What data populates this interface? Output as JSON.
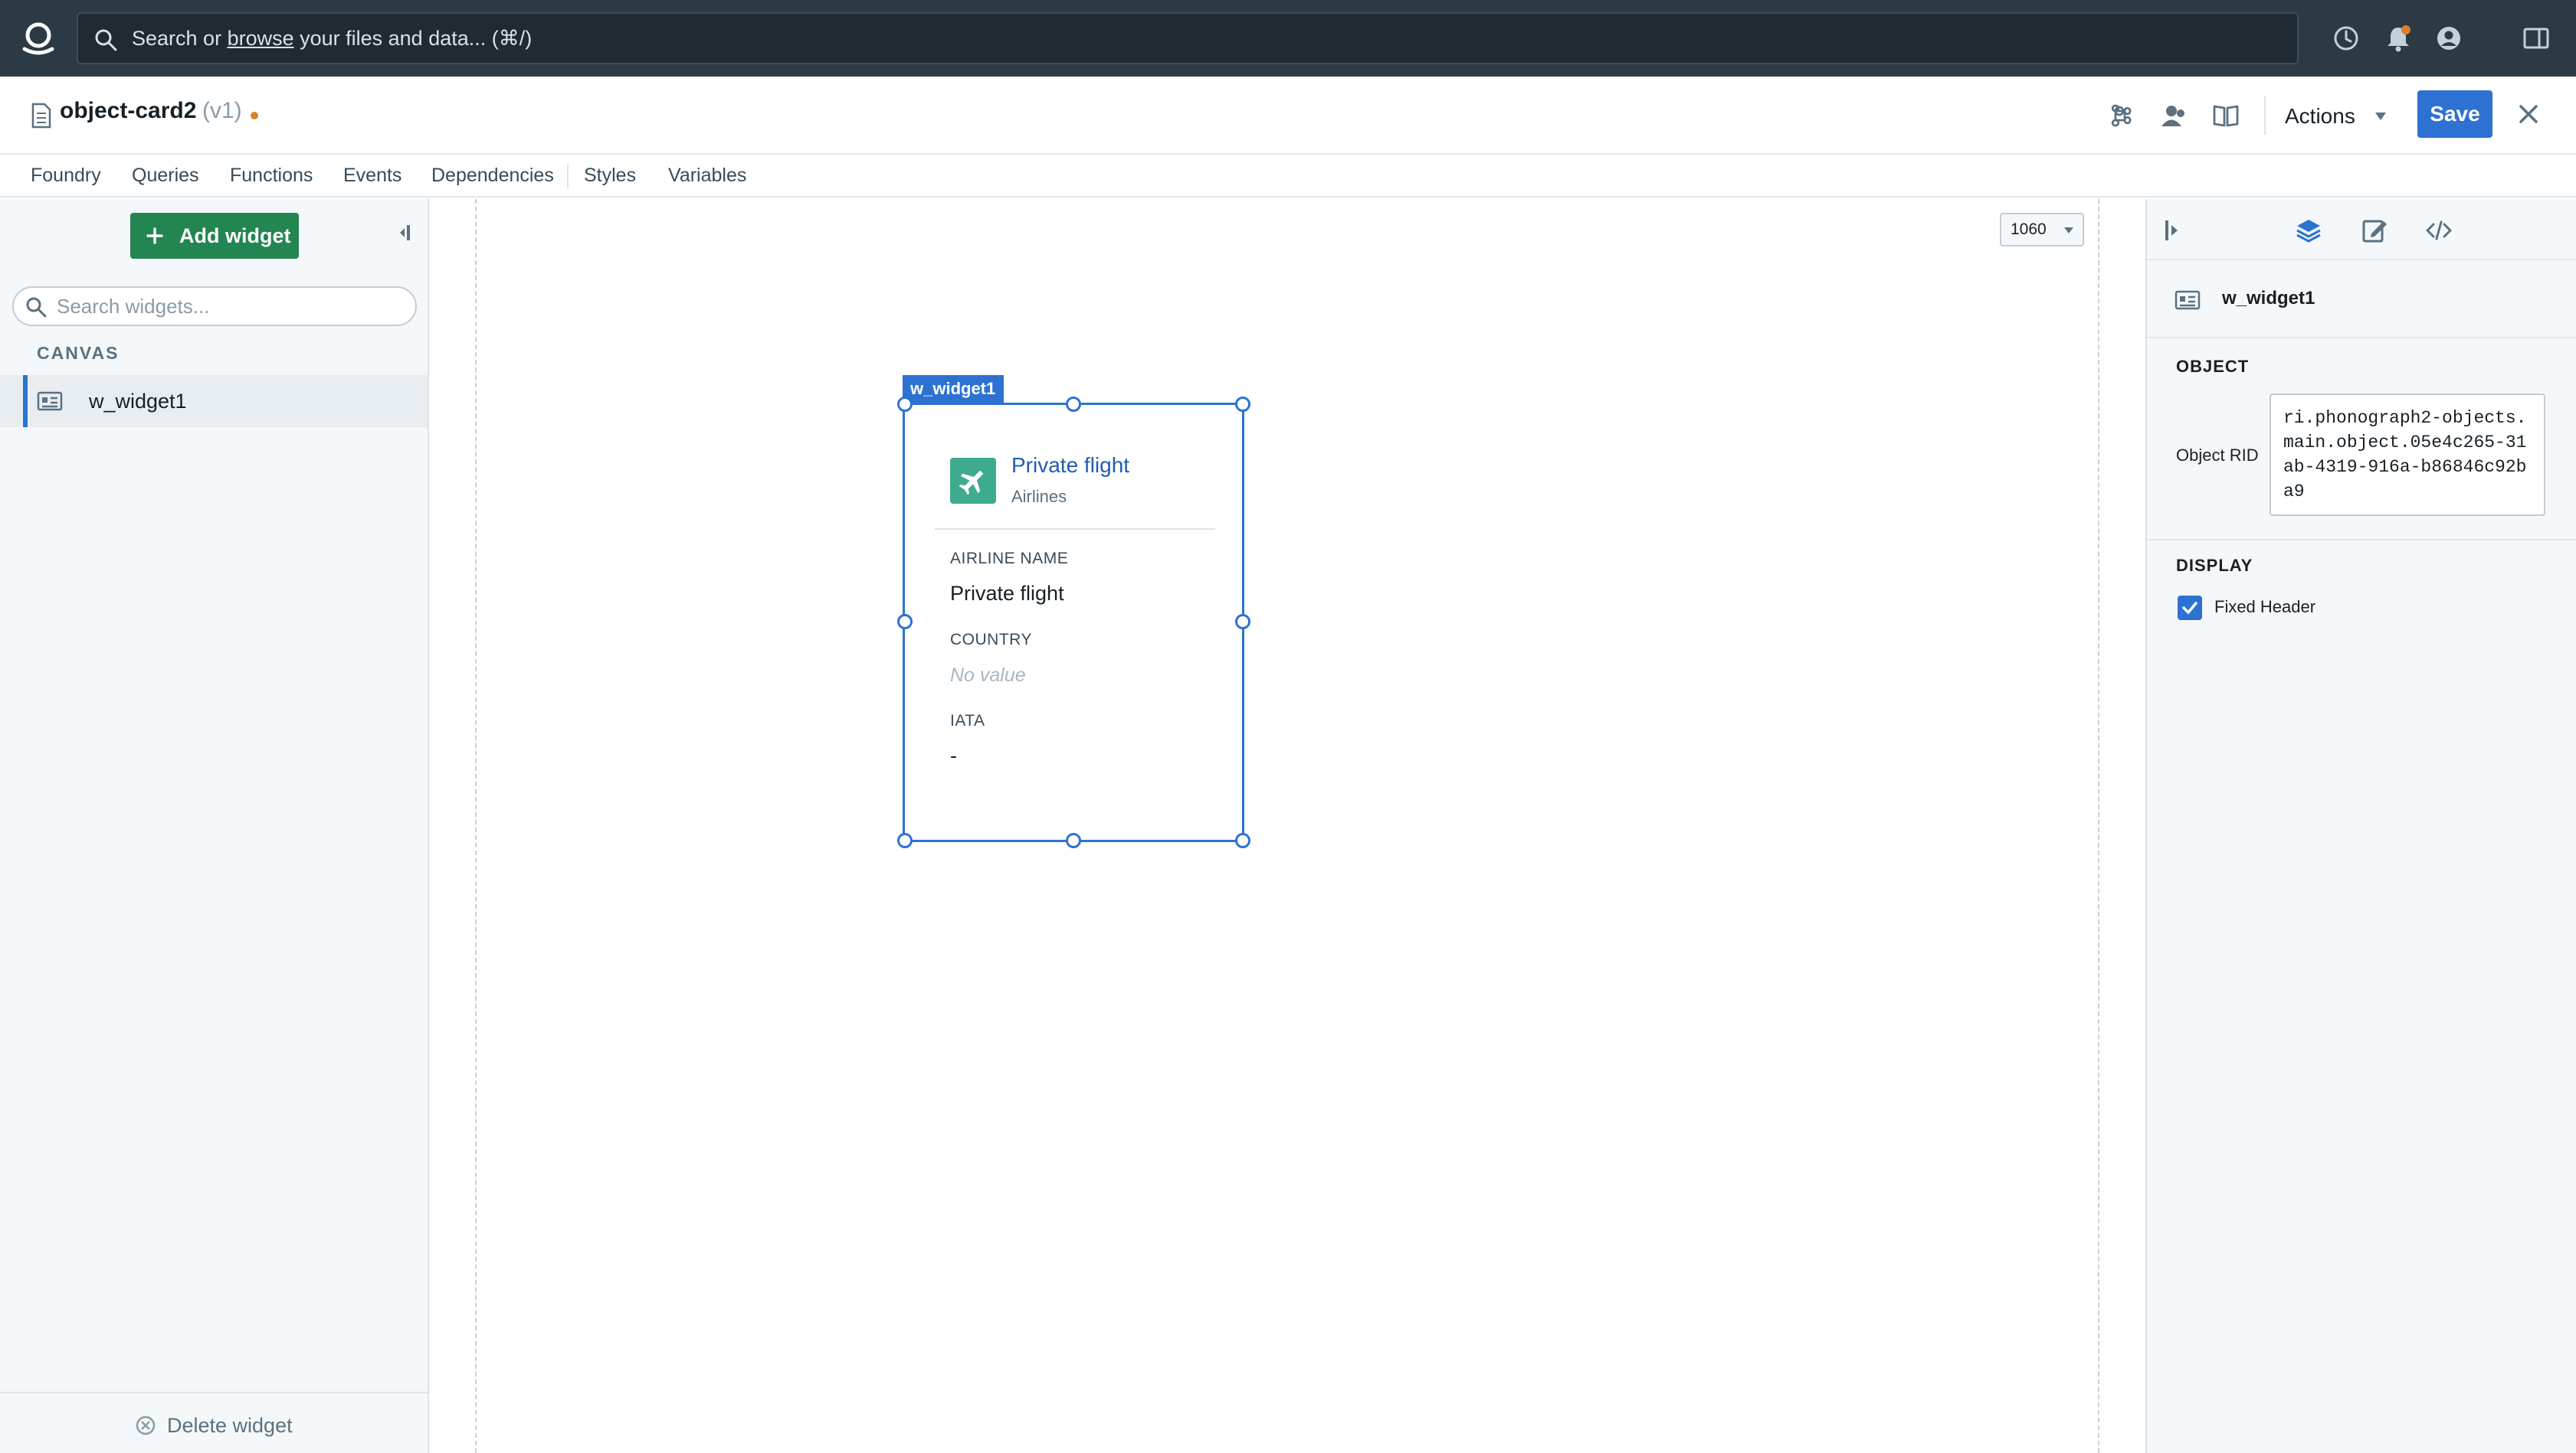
{
  "topbar": {
    "search_prefix": "Search or ",
    "search_link": "browse",
    "search_suffix": " your files and data... (⌘/)",
    "icons": [
      "foundry-logo-icon",
      "search-icon",
      "help-icon",
      "notifications-icon",
      "account-icon",
      "sidebar-toggle-icon"
    ]
  },
  "header": {
    "title": "object-card2",
    "version": "(v1)",
    "actions_label": "Actions",
    "save_label": "Save",
    "icons": [
      "command-icon",
      "collaborators-icon",
      "docs-book-icon",
      "chevron-down-icon",
      "close-icon"
    ]
  },
  "menu": {
    "items": [
      "Foundry",
      "Queries",
      "Functions",
      "Events",
      "Dependencies",
      "Styles",
      "Variables"
    ]
  },
  "left_panel": {
    "add_widget_label": "Add widget",
    "search_placeholder": "Search widgets...",
    "section_heading": "CANVAS",
    "tree_items": [
      {
        "label": "w_widget1",
        "icon": "object-card-icon",
        "selected": true
      }
    ],
    "delete_label": "Delete widget"
  },
  "canvas": {
    "zoom_value": "1060",
    "widget": {
      "tag": "w_widget1",
      "title": "Private flight",
      "subtitle": "Airlines",
      "icon": "airplane-icon",
      "properties": [
        {
          "label": "AIRLINE NAME",
          "value": "Private flight",
          "empty": false
        },
        {
          "label": "COUNTRY",
          "value": "No value",
          "empty": true
        },
        {
          "label": "IATA",
          "value": "-",
          "empty": false
        }
      ]
    }
  },
  "right_panel": {
    "tabs": [
      "collapse-panel-icon",
      "layers-icon",
      "edit-icon",
      "code-icon"
    ],
    "selected_widget": "w_widget1",
    "object_section": "OBJECT",
    "object_rid_label": "Object RID",
    "object_rid_value": "ri.phonograph2-objects.main.object.05e4c265-31ab-4319-916a-b86846c92ba9",
    "display_section": "DISPLAY",
    "fixed_header_label": "Fixed Header",
    "fixed_header_checked": true
  },
  "colors": {
    "topbar_bg": "#2b3a45",
    "accent_blue": "#2d72d2",
    "success_green": "#238551",
    "card_icon_teal": "#3eab8f",
    "dirty_orange": "#d9822b"
  }
}
